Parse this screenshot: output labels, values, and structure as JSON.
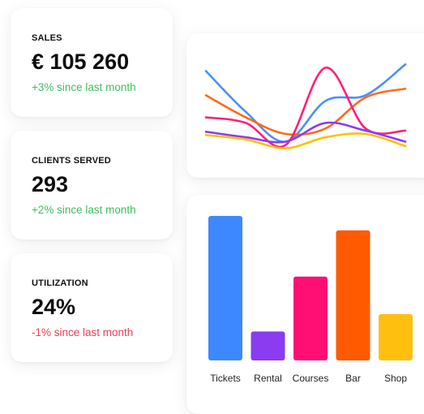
{
  "stats": [
    {
      "label": "SALES",
      "value": "€ 105 260",
      "change": "+3% since last month",
      "change_color": "#3fbf5f"
    },
    {
      "label": "CLIENTS SERVED",
      "value": "293",
      "change": "+2% since last month",
      "change_color": "#3fbf5f"
    },
    {
      "label": "UTILIZATION",
      "value": "24%",
      "change": "-1% since last month",
      "change_color": "#ef3b5a"
    }
  ],
  "chart_data": [
    {
      "type": "line",
      "title": "",
      "xlabel": "",
      "ylabel": "",
      "grid": false,
      "x": [
        0,
        1,
        2,
        3,
        4,
        5
      ],
      "ylim": [
        0,
        100
      ],
      "series": [
        {
          "color": "#4a90ff",
          "values": [
            82,
            45,
            18,
            55,
            60,
            88
          ]
        },
        {
          "color": "#ff6a1a",
          "values": [
            60,
            40,
            25,
            30,
            58,
            66
          ]
        },
        {
          "color": "#ff1f7a",
          "values": [
            40,
            35,
            15,
            85,
            30,
            28
          ]
        },
        {
          "color": "#8a3cf0",
          "values": [
            27,
            22,
            18,
            35,
            28,
            18
          ]
        },
        {
          "color": "#ffbf00",
          "values": [
            24,
            20,
            12,
            22,
            25,
            14
          ]
        }
      ]
    },
    {
      "type": "bar",
      "title": "",
      "xlabel": "",
      "ylabel": "",
      "grid": false,
      "categories": [
        "Tickets",
        "Rental",
        "Courses",
        "Bar",
        "Shop"
      ],
      "values": [
        100,
        20,
        58,
        90,
        32
      ],
      "colors": [
        "#3d88ff",
        "#8a3cf0",
        "#ff0f74",
        "#ff5a00",
        "#ffbf0f"
      ],
      "ylim": [
        0,
        100
      ]
    }
  ]
}
